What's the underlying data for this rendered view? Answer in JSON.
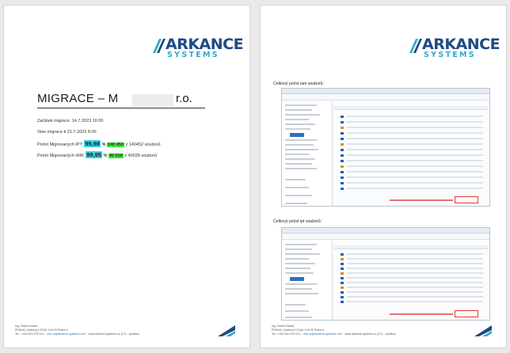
{
  "page1": {
    "logo": {
      "word1": "ARKANCE",
      "word2": "SYSTEMS"
    },
    "title": {
      "part1": "MIGRACE – M",
      "part2": "r.o."
    },
    "lines": {
      "start": "Začátek migrace: 14.7.2023 16:00",
      "state": "Stav migrace k 21.7.2023 8:00",
      "ipt_prefix": "Počet Migrovaných IPT:",
      "ipt_pct": "99,98",
      "ipt_unit": "%",
      "ipt_count": "140 450",
      "ipt_suffix": "z 140452 souborů",
      "iam_prefix": "Počet Migrovaných IAM:",
      "iam_pct": "99,95",
      "iam_unit": "%",
      "iam_count": "40 018",
      "iam_suffix": "z 40039 souborů"
    },
    "footer": {
      "line1": "Ing. David Kekela",
      "line2": "PRAHA, Libalova 1/2348, 149 00 Praha 4",
      "line3a": "Tel.: +420 910 976 111 – ",
      "line3b": "info.cz@arkance-systems.com",
      "line3c": " · www.arkance-systems.cz (CS – (služba)"
    }
  },
  "page2": {
    "logo": {
      "word1": "ARKANCE",
      "word2": "SYSTEMS"
    },
    "caption_iam": "Celkový počet iam souborů:",
    "caption_ipt": "Celkový počet ipt souborů:",
    "footer": {
      "line1": "Ing. David Kekela",
      "line2": "PRAHA, Libalova 1/2348, 149 00 Praha 4",
      "line3a": "Tel.: +420 910 976 111 – ",
      "line3b": "info.cz@arkance-systems.com",
      "line3c": " · www.arkance-systems.cz (CS – (služba)"
    }
  },
  "colors": {
    "brand_dark": "#1f4a84",
    "brand_light": "#34a8c7",
    "pct_highlight": "#3ad6e6",
    "count_highlight": "#33ee33",
    "callout_red": "#e53935"
  }
}
